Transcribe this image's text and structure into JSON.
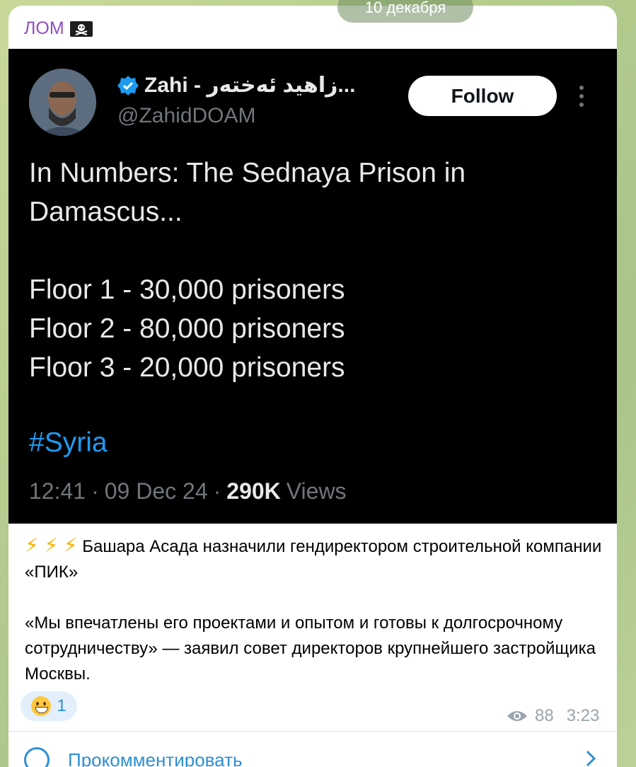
{
  "date_label": "10 декабря",
  "channel": {
    "name": "ЛОМ",
    "flag_icon": "pirate-flag-icon"
  },
  "tweet": {
    "author_name": "Zahi - زاهید ئەختەر...",
    "author_handle": "@ZahidDOAM",
    "follow_label": "Follow",
    "text": "In Numbers: The Sednaya Prison in\nDamascus...\n\nFloor 1 - 30,000 prisoners\nFloor 2 - 80,000 prisoners\nFloor 3 - 20,000 prisoners",
    "hashtag": "#Syria",
    "time": "12:41",
    "date": "09 Dec 24",
    "views_count": "290K",
    "views_label": "Views",
    "sep": "·"
  },
  "post": {
    "lightning": "⚡ ⚡ ⚡",
    "line1": "Башара Асада назначили гендиректором строительной компании «ПИК»",
    "line2": "«Мы впечатлены его проектами и опытом и готовы к долгосрочному сотрудничеству» — заявил совет директоров крупнейшего застройщика Москвы."
  },
  "reaction": {
    "emoji": "grinning-face",
    "count": "1"
  },
  "meta": {
    "views": "88",
    "time": "3:23"
  },
  "comment_label": "Прокомментировать",
  "colors": {
    "channel_name": "#8e4fc2",
    "link_blue": "#2d8fd5",
    "tweet_bg": "#000000",
    "hashtag": "#1d9bf0"
  }
}
